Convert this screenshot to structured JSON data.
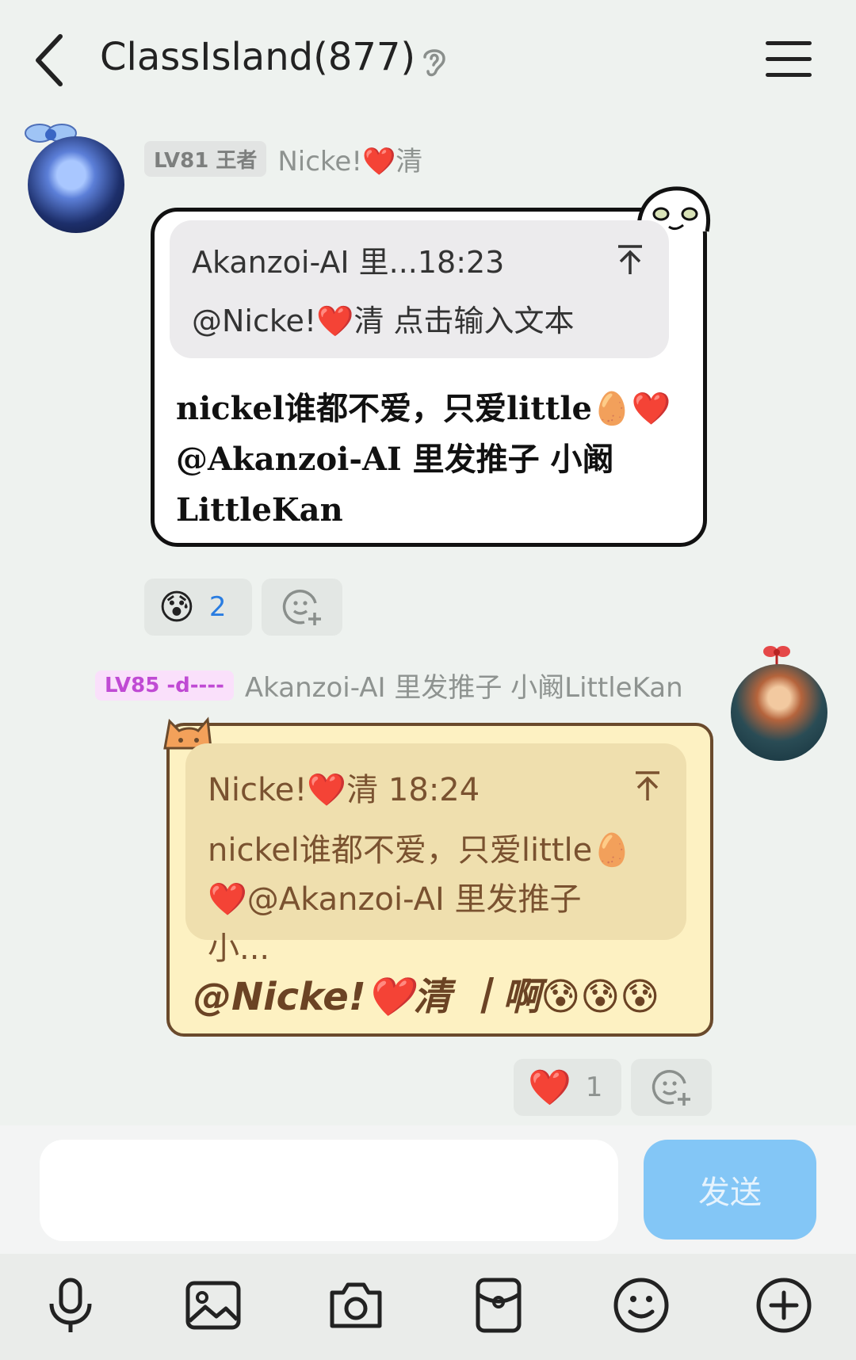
{
  "header": {
    "title": "ClassIsland(877)"
  },
  "messages": [
    {
      "level": "LV81 王者",
      "sender": "Nicke!❤️清",
      "quote_meta": "Akanzoi-AI 里...18:23",
      "quote_text": "@Nicke!❤️清 点击输入文本",
      "text": "nickel谁都不爱，只爱little🥚❤️@Akanzoi-AI 里发推子 小阚LittleKan",
      "reaction_emoji": "😰",
      "reaction_count": "2"
    },
    {
      "level": "LV85 -d----",
      "sender": "Akanzoi-AI 里发推子 小阚LittleKan",
      "quote_meta": "Nicke!❤️清 18:24",
      "quote_text": "nickel谁都不爱，只爱little🥚❤️@Akanzoi-AI 里发推子 小...",
      "text": "@Nicke!❤️清 丨啊😰😰😰",
      "reaction_emoji": "❤️",
      "reaction_count": "1"
    }
  ],
  "composer": {
    "input_value": "",
    "send_label": "发送"
  },
  "toolbar": {
    "icons": [
      "microphone-icon",
      "image-icon",
      "camera-icon",
      "red-packet-icon",
      "emoji-icon",
      "plus-icon"
    ]
  },
  "colors": {
    "send_button": "#83c6f6",
    "badge_level_2": "#c04ad4",
    "reaction_count_1": "#2a7de1"
  }
}
